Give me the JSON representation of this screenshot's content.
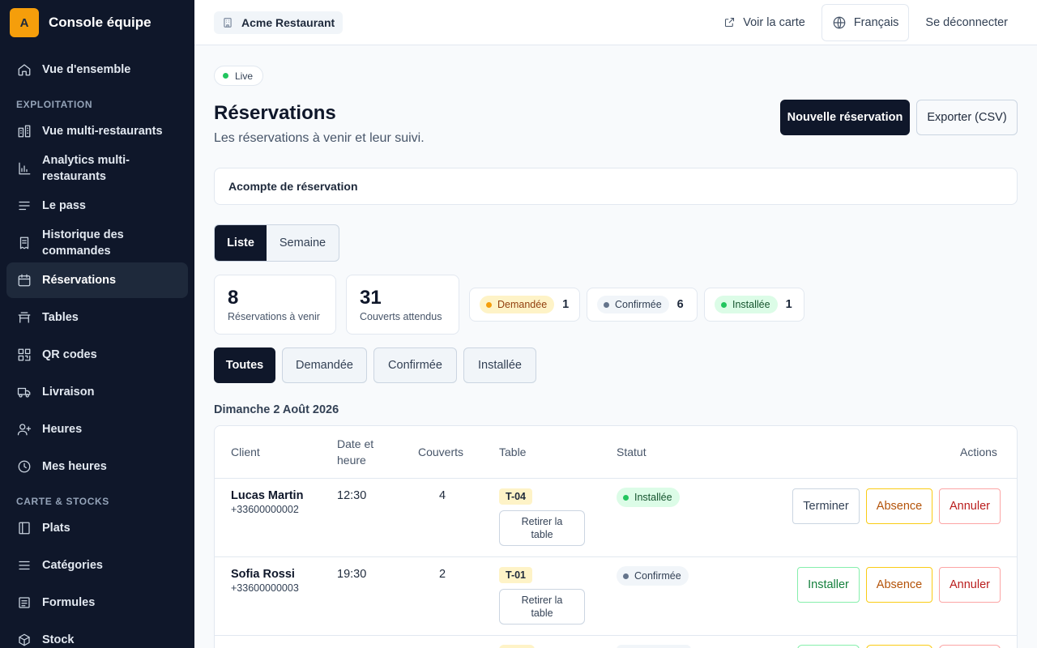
{
  "brand": {
    "initial": "A",
    "name": "Console équipe"
  },
  "sidebar": {
    "overview": "Vue d'ensemble",
    "section_ops": "EXPLOITATION",
    "ops_items": [
      "Vue multi-restaurants",
      "Analytics multi-restaurants",
      "Le pass",
      "Historique des commandes",
      "Réservations",
      "Tables",
      "QR codes",
      "Livraison",
      "Heures",
      "Mes heures"
    ],
    "section_menu": "CARTE & STOCKS",
    "menu_items": [
      "Plats",
      "Catégories",
      "Formules",
      "Stock"
    ]
  },
  "topbar": {
    "restaurant": "Acme Restaurant",
    "view_menu": "Voir la carte",
    "language": "Français",
    "logout": "Se déconnecter"
  },
  "page": {
    "live": "Live",
    "title": "Réservations",
    "subtitle": "Les réservations à venir et leur suivi.",
    "new_button": "Nouvelle réservation",
    "export_button": "Exporter (CSV)",
    "deposit": "Acompte de réservation"
  },
  "view_toggle": {
    "list": "Liste",
    "week": "Semaine"
  },
  "stats": {
    "upcoming_value": "8",
    "upcoming_label": "Réservations à venir",
    "covers_value": "31",
    "covers_label": "Couverts attendus"
  },
  "status_counts": [
    {
      "label": "Demandée",
      "count": "1"
    },
    {
      "label": "Confirmée",
      "count": "6"
    },
    {
      "label": "Installée",
      "count": "1"
    }
  ],
  "filters": [
    "Toutes",
    "Demandée",
    "Confirmée",
    "Installée"
  ],
  "date_heading": "Dimanche 2 Août 2026",
  "table": {
    "headers": {
      "client": "Client",
      "datetime": "Date et heure",
      "covers": "Couverts",
      "table": "Table",
      "status": "Statut",
      "actions": "Actions"
    },
    "remove_label": "Retirer la table",
    "rows": [
      {
        "name": "Lucas Martin",
        "phone": "+33600000002",
        "time": "12:30",
        "covers": "4",
        "table": "T-04",
        "status": "Installée",
        "actions": [
          "Terminer",
          "Absence",
          "Annuler"
        ]
      },
      {
        "name": "Sofia Rossi",
        "phone": "+33600000003",
        "time": "19:30",
        "covers": "2",
        "table": "T-01",
        "status": "Confirmée",
        "actions": [
          "Installer",
          "Absence",
          "Annuler"
        ]
      }
    ]
  },
  "colors": {
    "sidebar_bg": "#0f172a",
    "accent": "#f59e0b",
    "primary": "#0f172a",
    "success": "#22c55e",
    "warning": "#f59e0b",
    "danger": "#b91c1c"
  }
}
